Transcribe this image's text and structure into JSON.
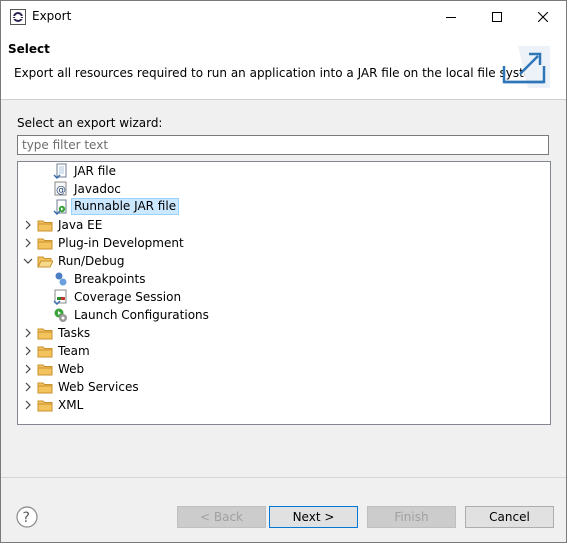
{
  "window": {
    "title": "Export",
    "controls": [
      "minimize",
      "maximize",
      "close"
    ]
  },
  "banner": {
    "title": "Select",
    "description": "Export all resources required to run an application into a JAR file on the local file system.",
    "image": "export-wizard-icon"
  },
  "wizard": {
    "select_label": "Select an export wizard:",
    "filter_placeholder": "type filter text",
    "tree": [
      {
        "label": "JAR file",
        "level": 2,
        "icon": "jar-file-icon"
      },
      {
        "label": "Javadoc",
        "level": 2,
        "icon": "javadoc-icon"
      },
      {
        "label": "Runnable JAR file",
        "level": 2,
        "icon": "runnable-jar-icon",
        "selected": true
      },
      {
        "label": "Java EE",
        "level": 1,
        "icon": "folder-icon",
        "expanded": false
      },
      {
        "label": "Plug-in Development",
        "level": 1,
        "icon": "folder-icon",
        "expanded": false
      },
      {
        "label": "Run/Debug",
        "level": 1,
        "icon": "folder-icon",
        "expanded": true
      },
      {
        "label": "Breakpoints",
        "level": 2,
        "icon": "breakpoints-icon"
      },
      {
        "label": "Coverage Session",
        "level": 2,
        "icon": "coverage-session-icon"
      },
      {
        "label": "Launch Configurations",
        "level": 2,
        "icon": "launch-configurations-icon"
      },
      {
        "label": "Tasks",
        "level": 1,
        "icon": "folder-icon",
        "expanded": false
      },
      {
        "label": "Team",
        "level": 1,
        "icon": "folder-icon",
        "expanded": false
      },
      {
        "label": "Web",
        "level": 1,
        "icon": "folder-icon",
        "expanded": false
      },
      {
        "label": "Web Services",
        "level": 1,
        "icon": "folder-icon",
        "expanded": false
      },
      {
        "label": "XML",
        "level": 1,
        "icon": "folder-icon",
        "expanded": false
      }
    ]
  },
  "buttons": {
    "help": "help-icon",
    "back": "< Back",
    "next": "Next >",
    "finish": "Finish",
    "cancel": "Cancel"
  },
  "colors": {
    "selection_bg": "#cce8ff",
    "folder": "#e8b14a",
    "default_button_border": "#0078d7"
  }
}
